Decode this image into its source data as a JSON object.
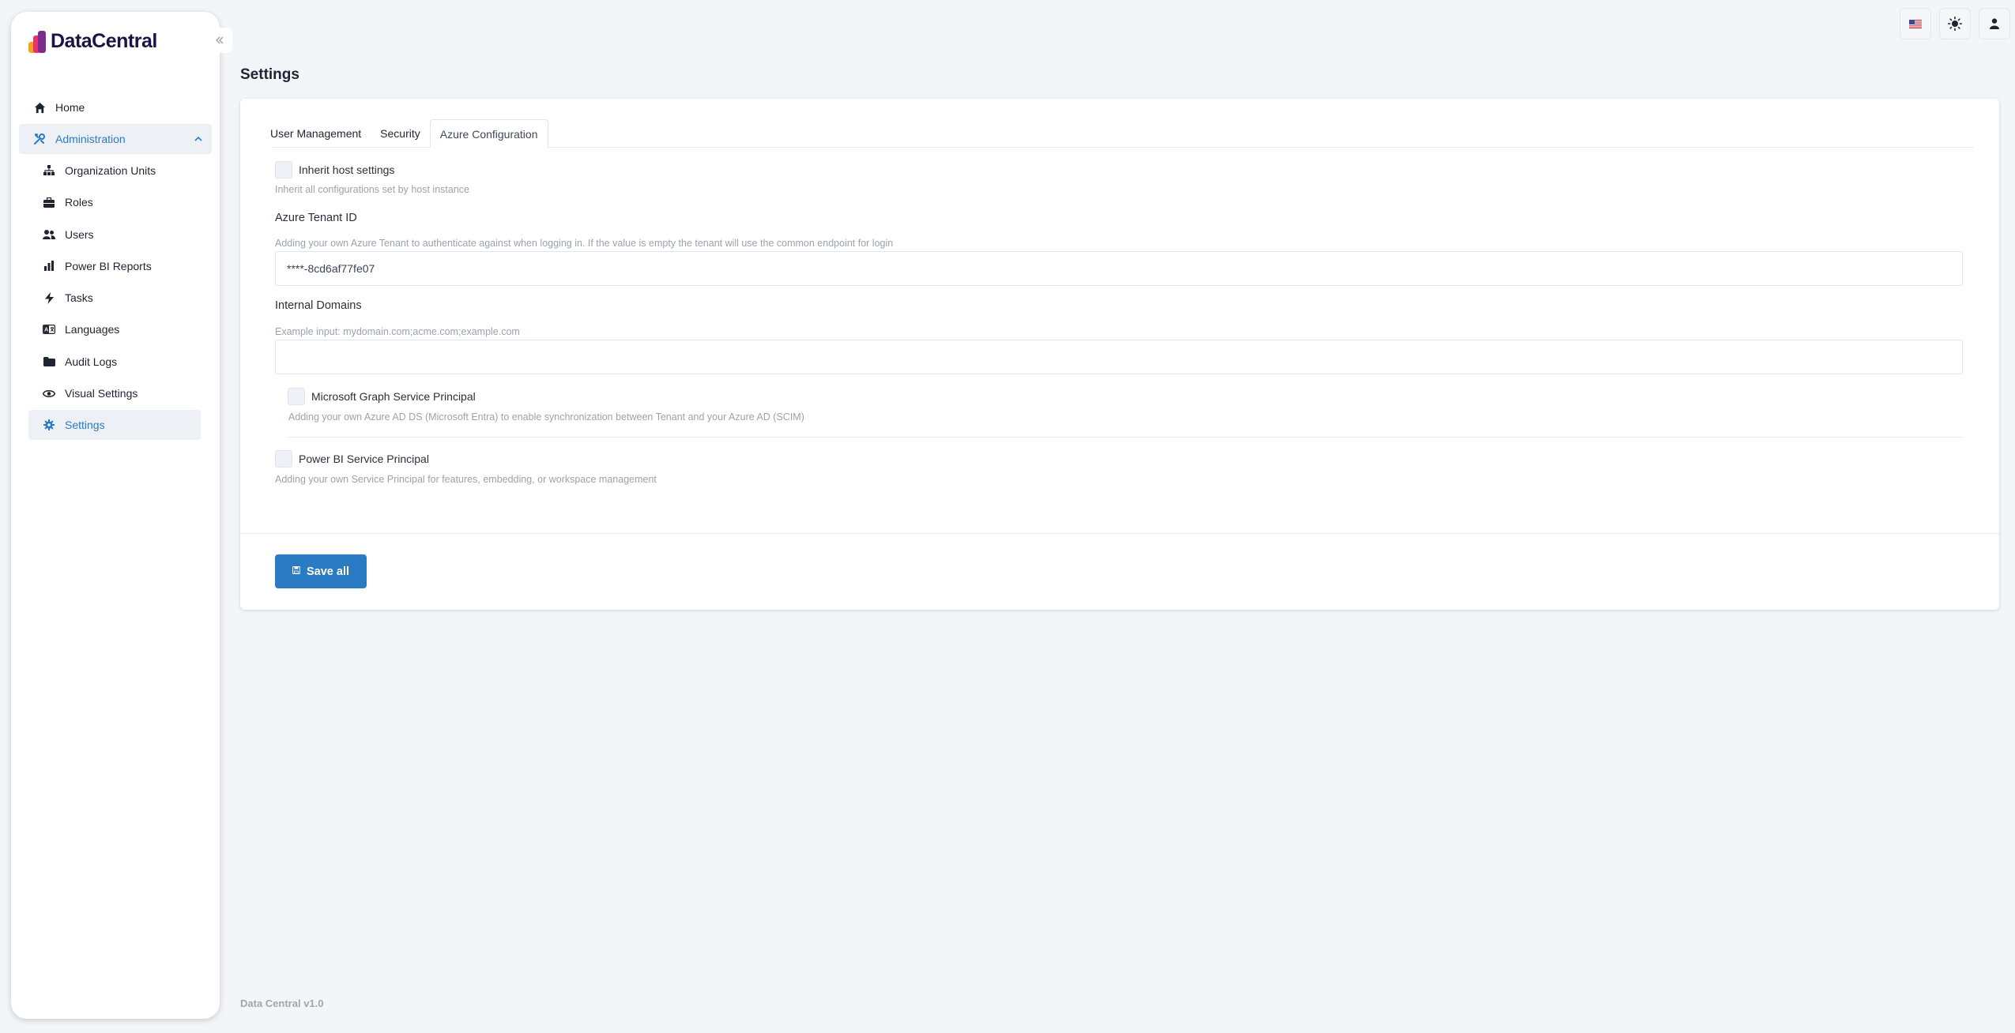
{
  "app": {
    "name": "DataCentral",
    "footer": "Data Central v1.0"
  },
  "sidebar": {
    "items": [
      {
        "label": "Home",
        "icon": "home-icon"
      },
      {
        "label": "Administration",
        "icon": "tools-icon"
      }
    ],
    "admin_items": [
      {
        "label": "Organization Units",
        "icon": "org-chart-icon"
      },
      {
        "label": "Roles",
        "icon": "briefcase-icon"
      },
      {
        "label": "Users",
        "icon": "users-icon"
      },
      {
        "label": "Power BI Reports",
        "icon": "bar-chart-icon"
      },
      {
        "label": "Tasks",
        "icon": "bolt-icon"
      },
      {
        "label": "Languages",
        "icon": "language-icon"
      },
      {
        "label": "Audit Logs",
        "icon": "folder-icon"
      },
      {
        "label": "Visual Settings",
        "icon": "eye-icon"
      },
      {
        "label": "Settings",
        "icon": "gear-icon"
      }
    ]
  },
  "header": {
    "language_icon": "us-flag-icon",
    "theme_icon": "sun-icon",
    "user_icon": "user-icon"
  },
  "page": {
    "title": "Settings"
  },
  "tabs": [
    {
      "label": "User Management"
    },
    {
      "label": "Security"
    },
    {
      "label": "Azure Configuration"
    }
  ],
  "azure": {
    "inherit_label": "Inherit host settings",
    "inherit_help": "Inherit all configurations set by host instance",
    "tenant_label": "Azure Tenant ID",
    "tenant_help": "Adding your own Azure Tenant to authenticate against when logging in. If the value is empty the tenant will use the common endpoint for login",
    "tenant_value": "****-8cd6af77fe07",
    "domains_label": "Internal Domains",
    "domains_help": "Example input: mydomain.com;acme.com;example.com",
    "domains_value": "",
    "graph_label": "Microsoft Graph Service Principal",
    "graph_help": "Adding your own Azure AD DS (Microsoft Entra) to enable synchronization between Tenant and your Azure AD (SCIM)",
    "powerbi_label": "Power BI Service Principal",
    "powerbi_help": "Adding your own Service Principal for features, embedding, or workspace management"
  },
  "actions": {
    "save_label": "Save all"
  },
  "colors": {
    "accent": "#2b7bc4",
    "background": "#f3f6f9",
    "logo_text": "#1a1446"
  }
}
